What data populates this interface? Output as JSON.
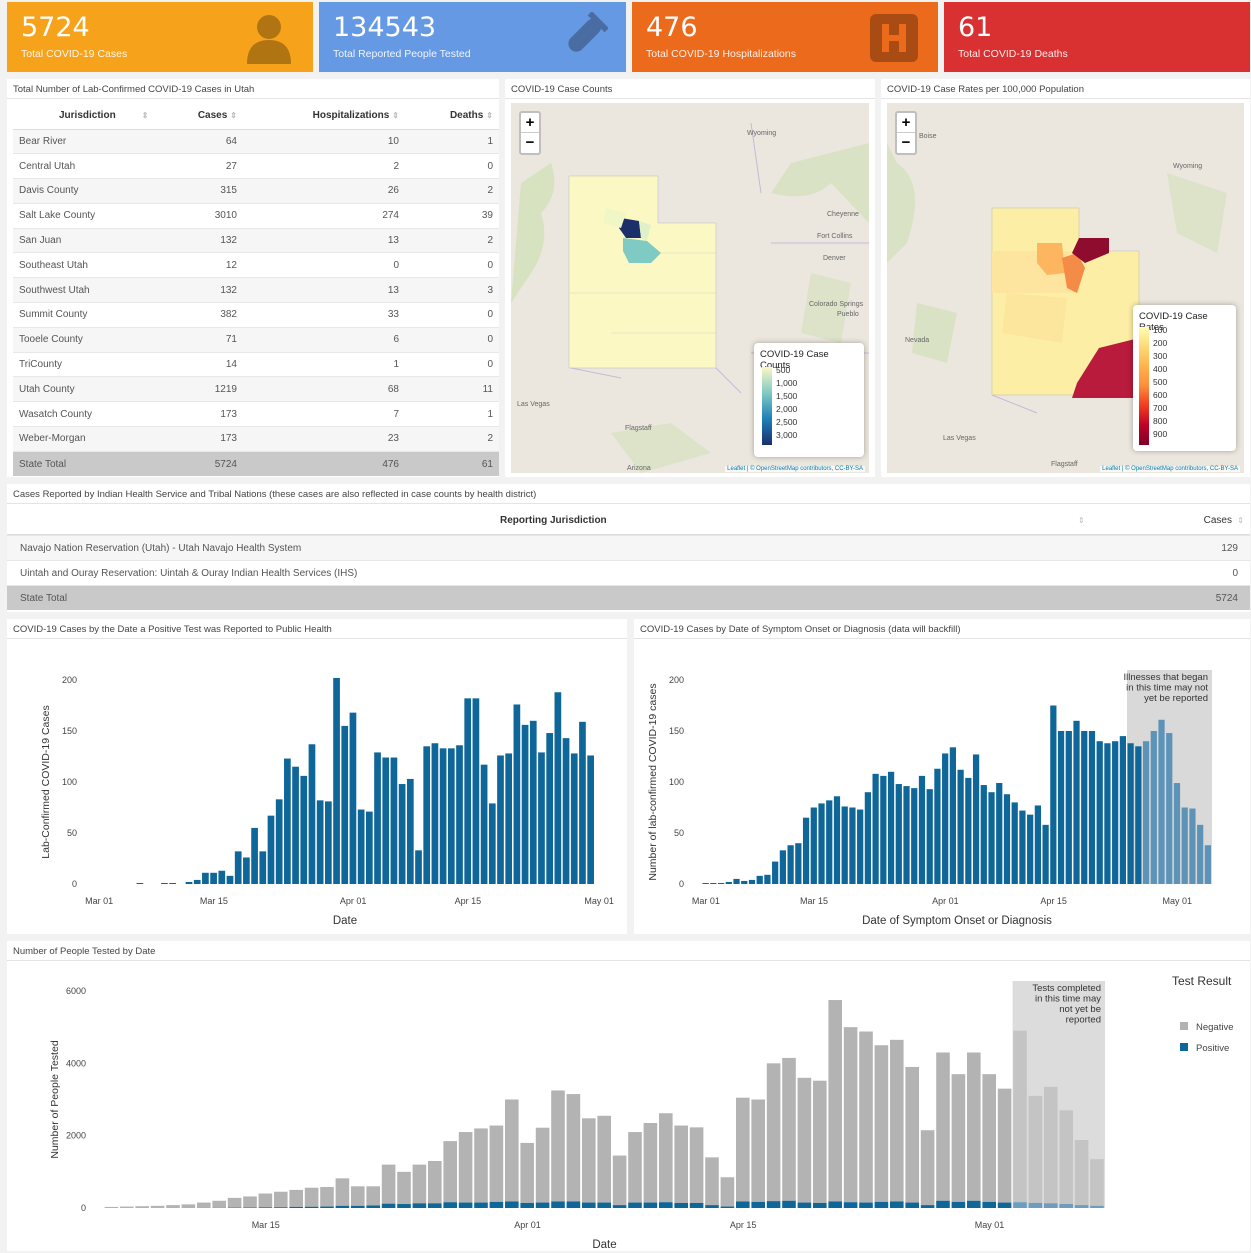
{
  "kpis": [
    {
      "value": "5724",
      "label": "Total COVID-19 Cases",
      "color": "#f7a21b",
      "icon": "person-icon"
    },
    {
      "value": "134543",
      "label": "Total Reported People Tested",
      "color": "#6699e3",
      "icon": "test-tube-icon"
    },
    {
      "value": "476",
      "label": "Total COVID-19 Hospitalizations",
      "color": "#ec6a1c",
      "icon": "hospital-icon"
    },
    {
      "value": "61",
      "label": "Total COVID-19 Deaths",
      "color": "#d93131",
      "icon": "deaths-icon"
    }
  ],
  "jurisdictions": {
    "title": "Total Number of Lab-Confirmed COVID-19 Cases in Utah",
    "columns": [
      "Jurisdiction",
      "Cases",
      "Hospitalizations",
      "Deaths"
    ],
    "rows": [
      [
        "Bear River",
        "64",
        "10",
        "1"
      ],
      [
        "Central Utah",
        "27",
        "2",
        "0"
      ],
      [
        "Davis County",
        "315",
        "26",
        "2"
      ],
      [
        "Salt Lake County",
        "3010",
        "274",
        "39"
      ],
      [
        "San Juan",
        "132",
        "13",
        "2"
      ],
      [
        "Southeast Utah",
        "12",
        "0",
        "0"
      ],
      [
        "Southwest Utah",
        "132",
        "13",
        "3"
      ],
      [
        "Summit County",
        "382",
        "33",
        "0"
      ],
      [
        "Tooele County",
        "71",
        "6",
        "0"
      ],
      [
        "TriCounty",
        "14",
        "1",
        "0"
      ],
      [
        "Utah County",
        "1219",
        "68",
        "11"
      ],
      [
        "Wasatch County",
        "173",
        "7",
        "1"
      ],
      [
        "Weber-Morgan",
        "173",
        "23",
        "2"
      ]
    ],
    "total": [
      "State Total",
      "5724",
      "476",
      "61"
    ]
  },
  "map_counts": {
    "title": "COVID-19 Case Counts",
    "legend_title": "COVID-19 Case Counts",
    "legend_items": [
      "500",
      "1,000",
      "1,500",
      "2,000",
      "2,500",
      "3,000"
    ],
    "attribution": "Leaflet | © OpenStreetMap contributors, CC-BY-SA",
    "cities": [
      "Wyoming",
      "Cheyenne",
      "Fort Collins",
      "Denver",
      "Colorado Springs",
      "Pueblo",
      "Las Vegas",
      "Flagstaff",
      "Arizona"
    ]
  },
  "map_rates": {
    "title": "COVID-19 Case Rates per 100,000 Population",
    "legend_title": "COVID-19 Case Rates",
    "legend_items": [
      "100",
      "200",
      "300",
      "400",
      "500",
      "600",
      "700",
      "800",
      "900"
    ],
    "attribution": "Leaflet | © OpenStreetMap contributors, CC-BY-SA",
    "cities": [
      "Boise",
      "Wyoming",
      "Nevada",
      "Las Vegas",
      "Flagstaff"
    ]
  },
  "zoom": {
    "in": "+",
    "out": "−"
  },
  "ihs": {
    "title": "Cases Reported by Indian Health Service and Tribal Nations (these cases are also reflected in case counts by health district)",
    "col_jurisdiction": "Reporting Jurisdiction",
    "col_cases": "Cases",
    "rows": [
      {
        "name": "Navajo Nation Reservation (Utah) - Utah Navajo Health System",
        "cases": "129"
      },
      {
        "name": "Uintah and Ouray Reservation: Uintah & Ouray Indian Health Services (IHS)",
        "cases": "0"
      }
    ],
    "total": {
      "name": "State Total",
      "cases": "5724"
    }
  },
  "chart1": {
    "panel_title": "COVID-19 Cases by the Date a Positive Test was Reported to Public Health"
  },
  "chart2": {
    "panel_title": "COVID-19 Cases by Date of Symptom Onset or Diagnosis (data will backfill)"
  },
  "chart3": {
    "panel_title": "Number of People Tested by Date"
  },
  "chart_data": [
    {
      "type": "bar",
      "xlabel": "Date",
      "ylabel": "Lab-Confirmed COVID-19 Cases",
      "ylim": [
        0,
        200
      ],
      "yticks": [
        0,
        50,
        100,
        150,
        200
      ],
      "xticks": [
        "Mar 01",
        "Mar 15",
        "Apr 01",
        "Apr 15",
        "May 01"
      ],
      "xtick_index": [
        0,
        14,
        31,
        45,
        61
      ],
      "start": "Mar 01",
      "color": "#0f6699",
      "values": [
        0,
        0,
        0,
        0,
        0,
        1,
        0,
        0,
        1,
        1,
        0,
        2,
        4,
        11,
        11,
        13,
        8,
        32,
        26,
        55,
        32,
        67,
        83,
        123,
        115,
        106,
        137,
        82,
        81,
        202,
        155,
        168,
        73,
        71,
        129,
        124,
        124,
        98,
        103,
        33,
        135,
        138,
        133,
        133,
        136,
        182,
        182,
        117,
        79,
        126,
        128,
        176,
        156,
        160,
        129,
        148,
        188,
        143,
        128,
        159,
        126
      ]
    },
    {
      "type": "bar",
      "xlabel": "Date of Symptom Onset or Diagnosis",
      "ylabel": "Number of lab-confirmed COVID-19 cases",
      "ylim": [
        0,
        200
      ],
      "yticks": [
        0,
        50,
        100,
        150,
        200
      ],
      "xticks": [
        "Mar 01",
        "Mar 15",
        "Apr 01",
        "Apr 15",
        "May 01"
      ],
      "xtick_index": [
        0,
        14,
        31,
        45,
        61
      ],
      "start": "Mar 01",
      "color": "#0f6699",
      "shade_color": "#d9d9d9",
      "annotation": "Illnesses that began in this time may not yet be reported",
      "shaded_from": 55,
      "values": [
        1,
        1,
        1,
        2,
        5,
        3,
        4,
        8,
        9,
        22,
        33,
        38,
        40,
        65,
        75,
        79,
        82,
        86,
        76,
        75,
        73,
        90,
        108,
        106,
        110,
        98,
        96,
        94,
        106,
        93,
        113,
        128,
        134,
        112,
        104,
        127,
        97,
        90,
        99,
        88,
        80,
        72,
        68,
        77,
        58,
        175,
        150,
        150,
        160,
        150,
        150,
        140,
        138,
        140,
        145,
        138,
        135,
        140,
        150,
        161,
        148,
        99,
        75,
        74,
        58,
        38
      ],
      "faded_from": 57
    },
    {
      "type": "bar",
      "xlabel": "Date",
      "ylabel": "Number of People Tested",
      "ylim": [
        0,
        6000
      ],
      "yticks": [
        0,
        2000,
        4000,
        6000
      ],
      "xticks": [
        "Mar 15",
        "Apr 01",
        "Apr 15",
        "May 01"
      ],
      "xtick_index": [
        10,
        27,
        41,
        57
      ],
      "start": "Mar 05",
      "legend_title": "Test Result",
      "series": [
        {
          "name": "Negative",
          "color": "#b3b3b3"
        },
        {
          "name": "Positive",
          "color": "#0f6699"
        }
      ],
      "annotation": "Tests completed in this time may not yet be reported",
      "shaded_from": 59,
      "totals": [
        30,
        40,
        50,
        60,
        80,
        100,
        150,
        200,
        280,
        320,
        400,
        450,
        500,
        560,
        580,
        820,
        600,
        600,
        1200,
        1000,
        1200,
        1300,
        1850,
        2100,
        2200,
        2280,
        3000,
        1800,
        2220,
        3250,
        3150,
        2480,
        2550,
        1450,
        2100,
        2350,
        2620,
        2280,
        2230,
        1400,
        850,
        3050,
        3000,
        4000,
        4150,
        3600,
        3520,
        5750,
        5000,
        4880,
        4500,
        4650,
        3900,
        2150,
        4300,
        3700,
        4300,
        3700,
        3300,
        4900,
        3100,
        3350,
        2700,
        1880,
        1350
      ],
      "positives": [
        0,
        0,
        0,
        0,
        0,
        1,
        2,
        4,
        10,
        12,
        18,
        20,
        30,
        35,
        40,
        60,
        60,
        70,
        120,
        110,
        130,
        130,
        160,
        150,
        150,
        170,
        180,
        140,
        150,
        180,
        180,
        150,
        150,
        80,
        150,
        150,
        160,
        140,
        140,
        80,
        40,
        180,
        170,
        190,
        200,
        150,
        140,
        180,
        160,
        150,
        170,
        180,
        150,
        80,
        200,
        170,
        200,
        170,
        150,
        160,
        140,
        130,
        110,
        80,
        60
      ]
    }
  ]
}
